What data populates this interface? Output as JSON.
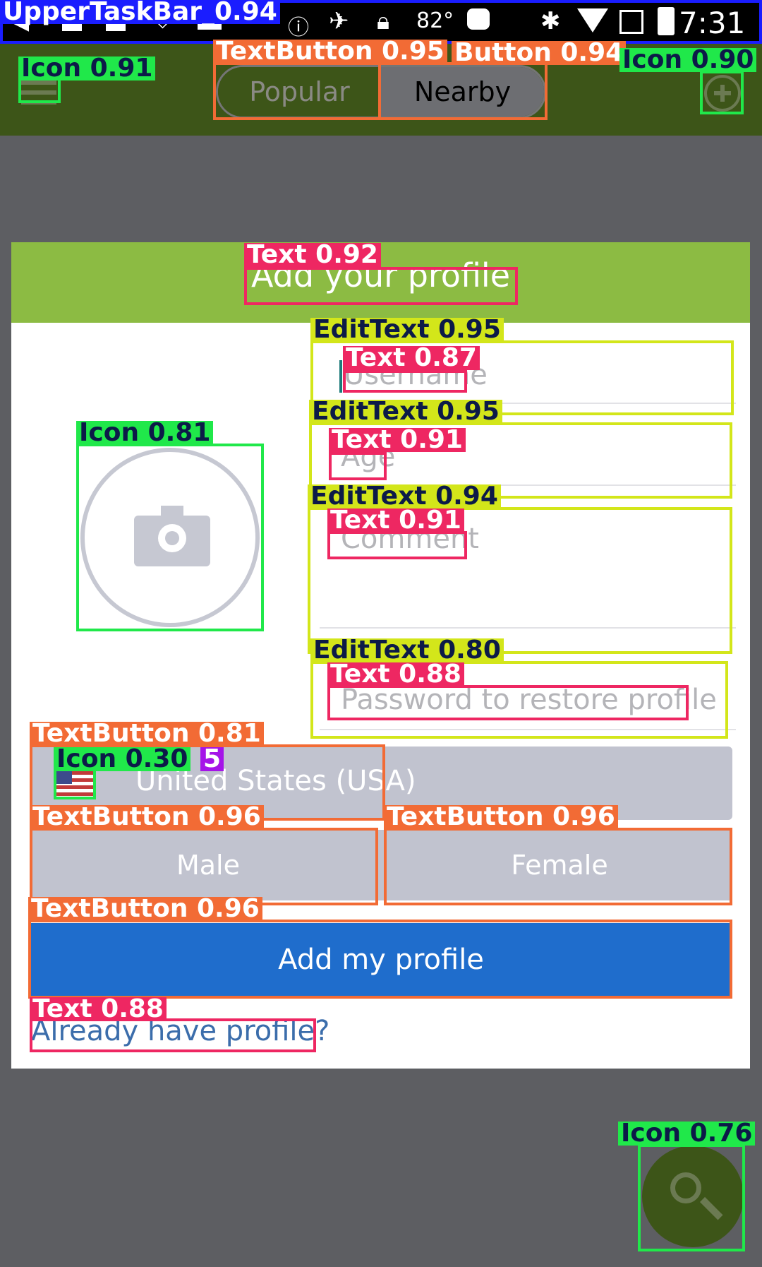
{
  "status_bar": {
    "temperature": "82°",
    "time": "7:31"
  },
  "app_bar": {
    "tabs": [
      {
        "label": "Popular",
        "selected": false
      },
      {
        "label": "Nearby",
        "selected": true
      }
    ],
    "menu_icon": "menu-icon",
    "add_icon": "add-circle-icon"
  },
  "dialog": {
    "title": "Add your profile",
    "photo_icon": "camera-icon",
    "username_placeholder": "Username",
    "age_placeholder": "Age",
    "comment_placeholder": "Comment",
    "password_placeholder": "Password to restore profile",
    "country": "United States (USA)",
    "male_label": "Male",
    "female_label": "Female",
    "submit_label": "Add my profile",
    "already_link": "Already have profile?"
  },
  "fab": {
    "icon": "search-icon"
  },
  "detection_overlay": {
    "labels": [
      "UpperTaskBar_0.94",
      "TextButton 0.95",
      "Button 0.94",
      "Icon 0.91",
      "Icon 0.90",
      "Text 0.92",
      "EditText 0.95",
      "Text 0.87",
      "Icon 0.81",
      "EditText 0.95",
      "Text 0.91",
      "EditText 0.94",
      "Text 0.91",
      "EditText 0.80",
      "Text 0.88",
      "TextButton 0.81",
      "Icon 0.30",
      "5",
      "TextButton 0.96",
      "TextButton 0.96",
      "TextButton 0.96",
      "Text 0.88",
      "Icon 0.76"
    ]
  },
  "colors": {
    "app_bar": "#3d5518",
    "dialog_header": "#8cbb43",
    "primary_button": "#1f6dcc",
    "secondary_button": "#c1c3cf",
    "fab": "#3d5518"
  }
}
